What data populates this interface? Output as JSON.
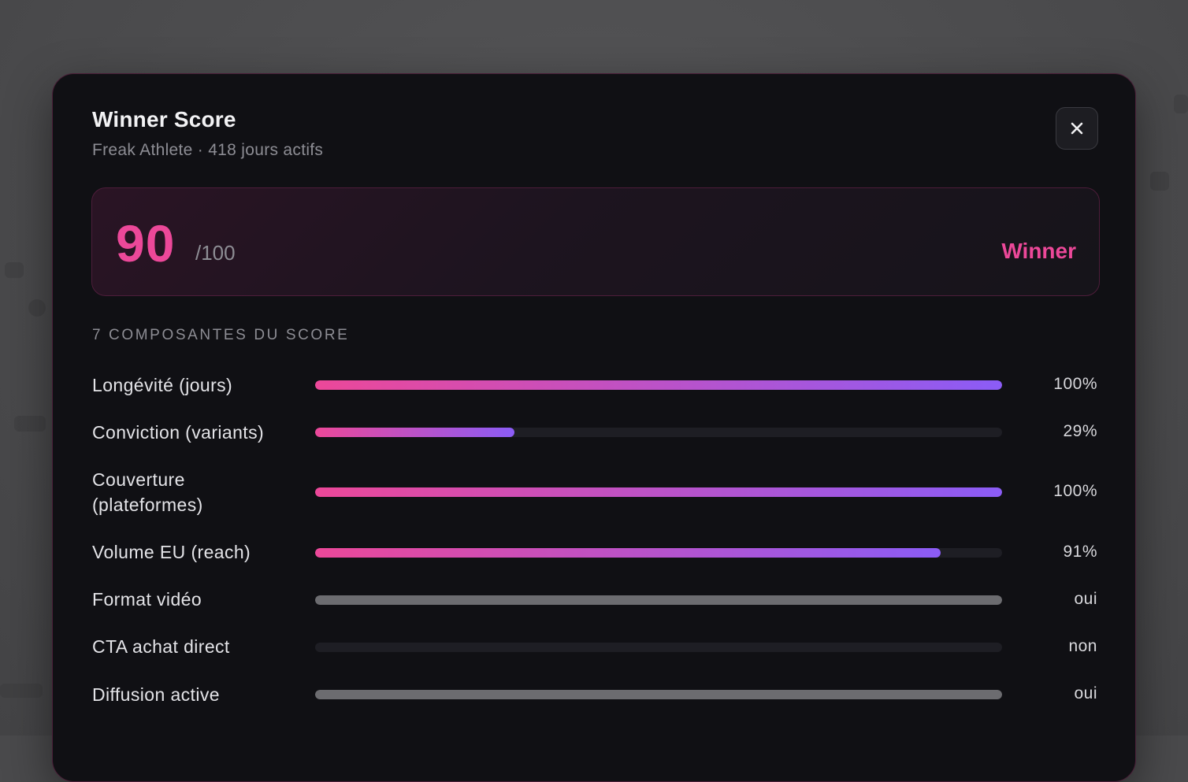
{
  "modal": {
    "title": "Winner Score",
    "subtitle": "Freak Athlete · 418 jours actifs",
    "close_icon": "close-icon"
  },
  "score": {
    "value": "90",
    "max": "/100",
    "verdict": "Winner"
  },
  "components": {
    "heading": "7 COMPOSANTES DU SCORE",
    "rows": [
      {
        "label": "Longévité (jours)",
        "value": "100%",
        "level": 1.0,
        "style": "gradient"
      },
      {
        "label": "Conviction (variants)",
        "value": "29%",
        "level": 0.29,
        "style": "gradient"
      },
      {
        "label": "Couverture (plateformes)",
        "value": "100%",
        "level": 1.0,
        "style": "gradient"
      },
      {
        "label": "Volume EU (reach)",
        "value": "91%",
        "level": 0.91,
        "style": "gradient"
      },
      {
        "label": "Format vidéo",
        "value": "oui",
        "level": 1.0,
        "style": "neutral"
      },
      {
        "label": "CTA achat direct",
        "value": "non",
        "level": 0.0,
        "style": "neutral"
      },
      {
        "label": "Diffusion active",
        "value": "oui",
        "level": 1.0,
        "style": "neutral"
      }
    ]
  },
  "colors": {
    "accent": "#ec4899",
    "gradient_end": "#8b5cf6",
    "neutral_bar": "#6c6c70",
    "track": "#1e1e24"
  }
}
